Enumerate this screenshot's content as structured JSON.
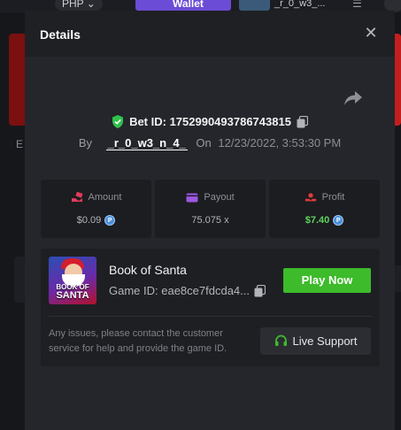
{
  "background": {
    "currency": "PHP ⌄",
    "wallet_label": "Wallet",
    "username_fragment": "_r_0_w3_...",
    "menu_glyph": "☰",
    "letter_fragment": "E"
  },
  "modal": {
    "title": "Details",
    "close_glyph": "✕"
  },
  "bet": {
    "id_label": "Bet ID: 1752990493786743815",
    "by_label": "By",
    "username": "_r_0_w3_n_4_",
    "on_label": "On",
    "date": "12/23/2022, 3:53:30 PM"
  },
  "stats": {
    "amount": {
      "label": "Amount",
      "value": "$0.09",
      "icon": "money-hand-icon",
      "color": "#e23b5a"
    },
    "payout": {
      "label": "Payout",
      "value": "75.075 x",
      "icon": "wallet-icon",
      "color": "#9b59e0"
    },
    "profit": {
      "label": "Profit",
      "value": "$7.40",
      "icon": "profit-icon",
      "color": "#e23b3b"
    }
  },
  "currency_coin": "P",
  "game": {
    "name": "Book of Santa",
    "id_label": "Game ID: eae8ce7fdcda4...",
    "play_label": "Play Now",
    "thumb_label_1": "BOOK OF",
    "thumb_label_2": "SANTA"
  },
  "support": {
    "text": "Any issues, please contact the customer service for help and provide the game ID.",
    "button_label": "Live Support"
  },
  "colors": {
    "accent_green": "#3dbb2b",
    "profit_green": "#5fd35a",
    "shield_green": "#2fc24a",
    "modal_bg": "#25262b",
    "header_bg": "#1f2024"
  }
}
